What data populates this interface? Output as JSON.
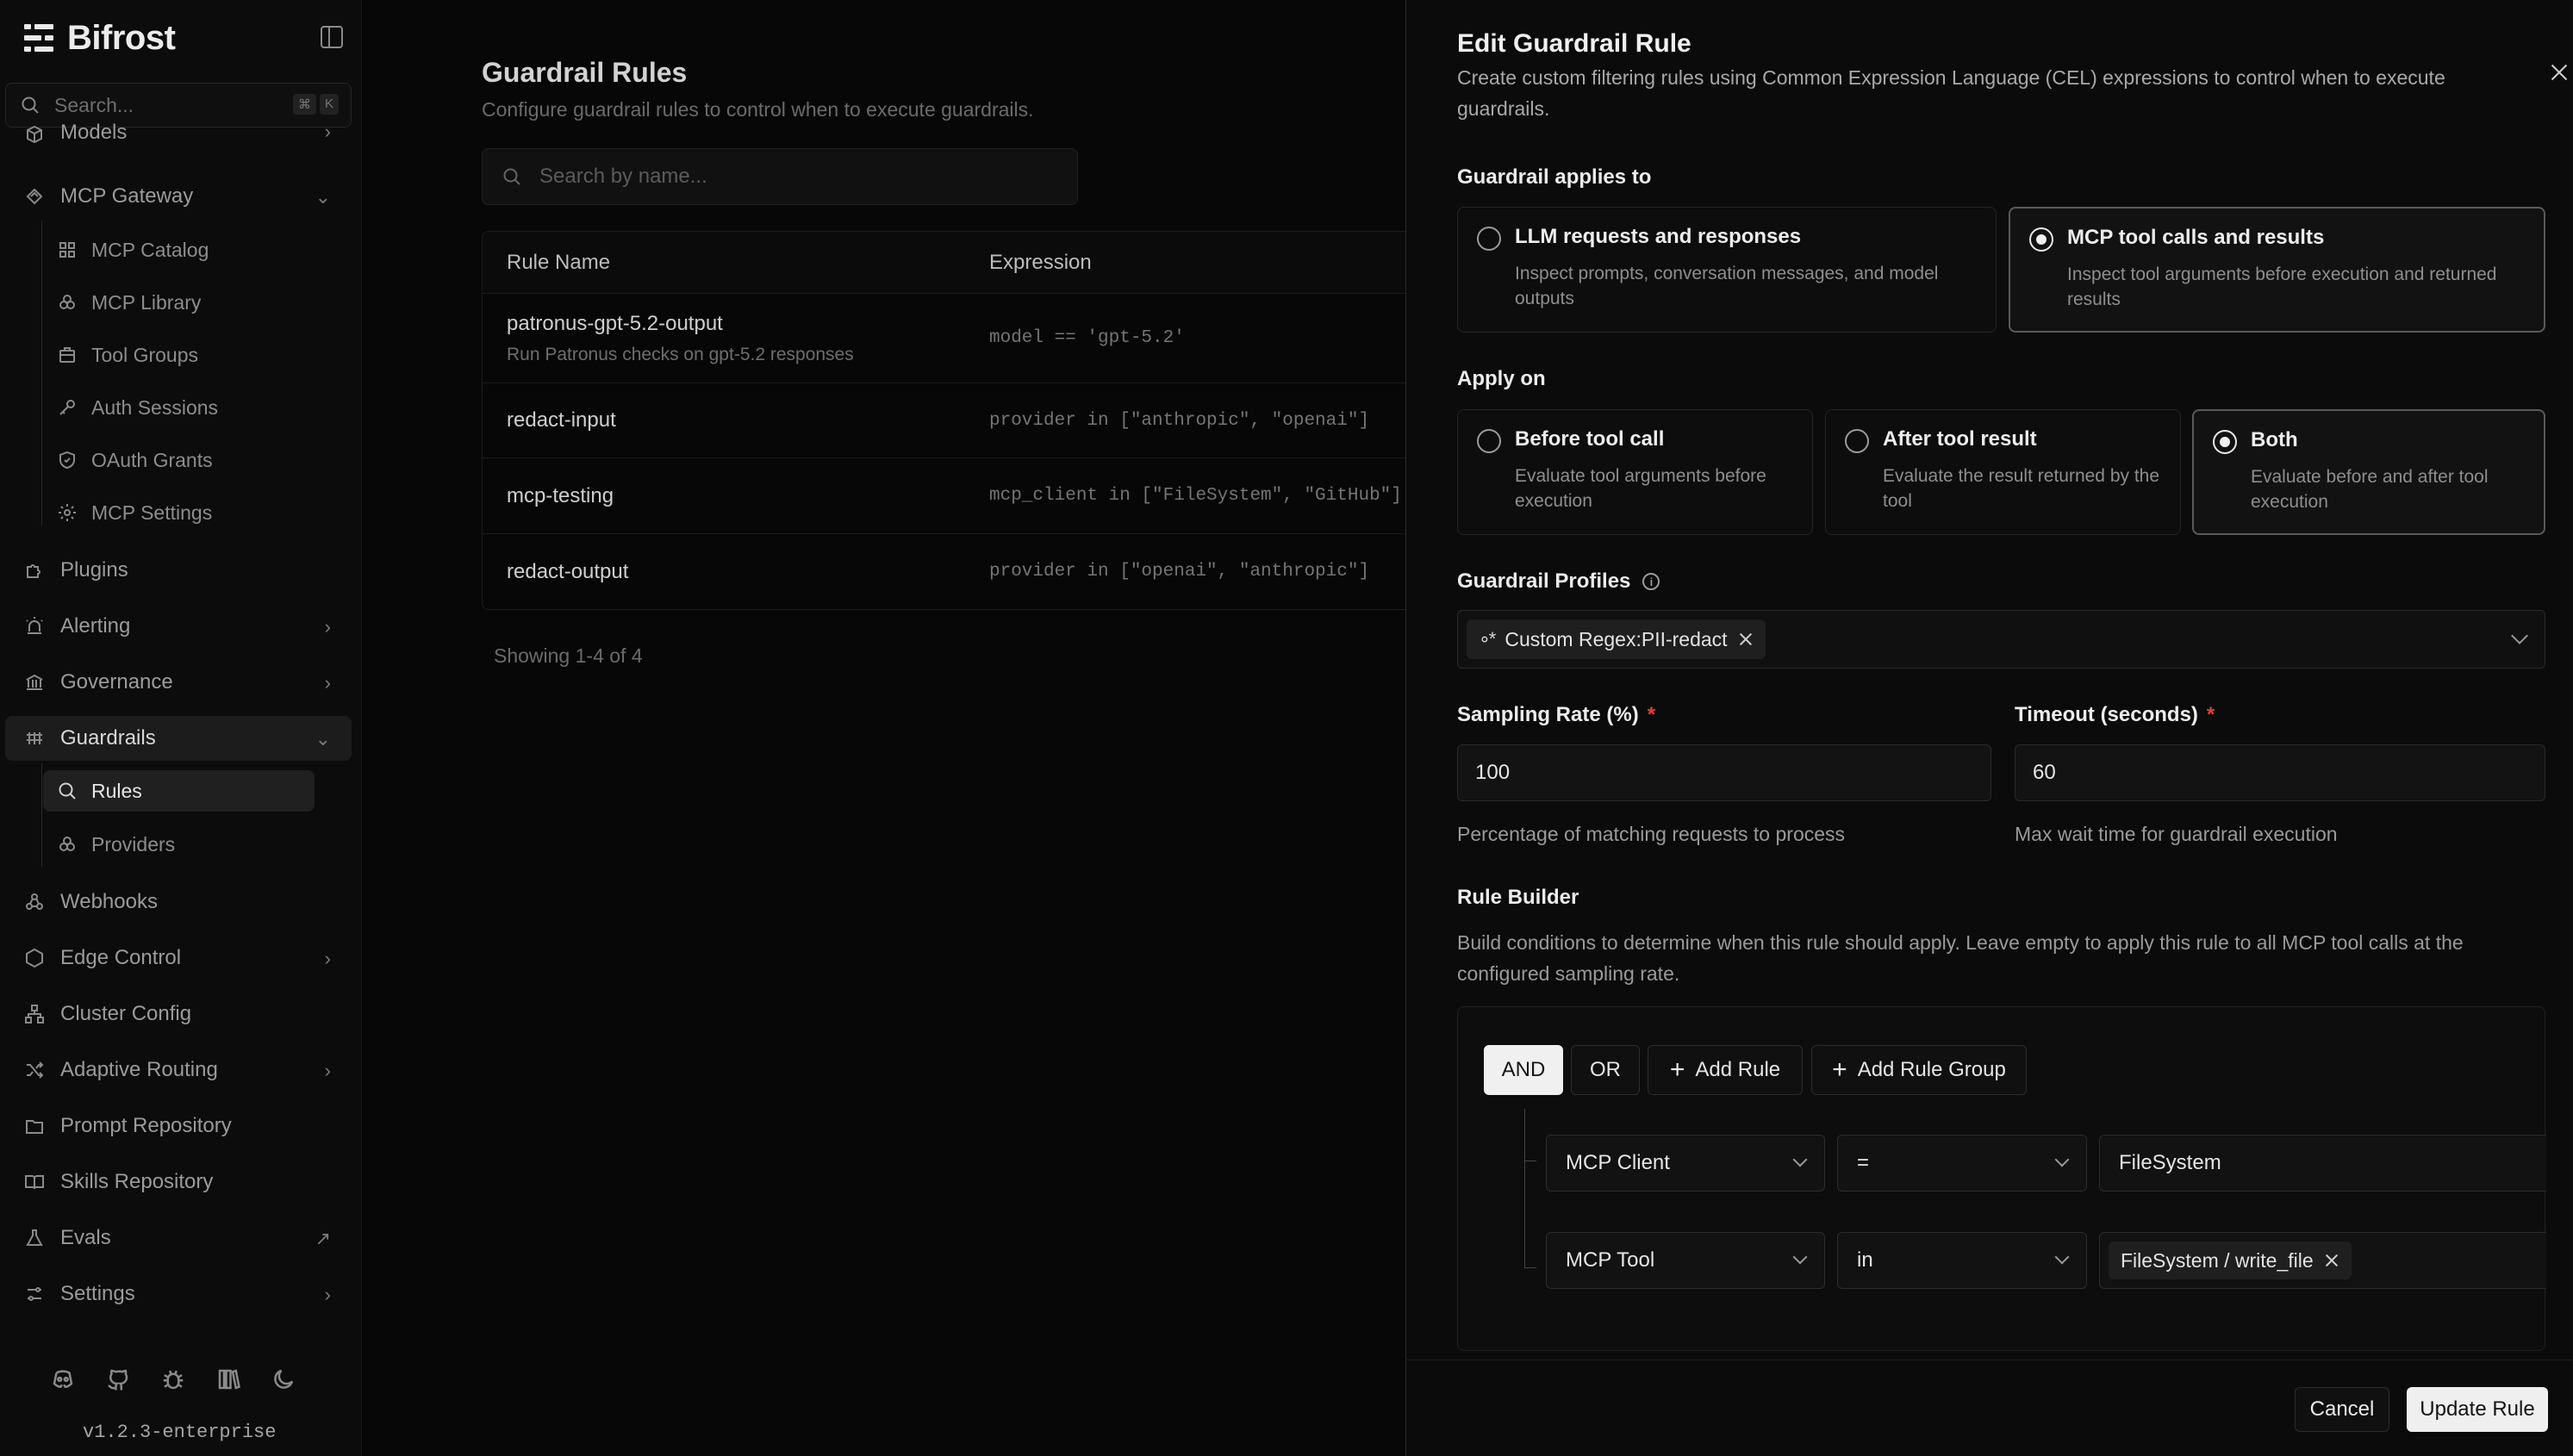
{
  "app": {
    "name": "Bifrost",
    "version": "v1.2.3-enterprise"
  },
  "sidebar": {
    "search_placeholder": "Search...",
    "shortcut": [
      "⌘",
      "K"
    ],
    "items": [
      {
        "label": "Models"
      },
      {
        "label": "MCP Gateway"
      },
      {
        "label": "MCP Catalog"
      },
      {
        "label": "MCP Library"
      },
      {
        "label": "Tool Groups"
      },
      {
        "label": "Auth Sessions"
      },
      {
        "label": "OAuth Grants"
      },
      {
        "label": "MCP Settings"
      },
      {
        "label": "Plugins"
      },
      {
        "label": "Alerting"
      },
      {
        "label": "Governance"
      },
      {
        "label": "Guardrails"
      },
      {
        "label": "Rules"
      },
      {
        "label": "Providers"
      },
      {
        "label": "Webhooks"
      },
      {
        "label": "Edge Control"
      },
      {
        "label": "Cluster Config"
      },
      {
        "label": "Adaptive Routing"
      },
      {
        "label": "Prompt Repository"
      },
      {
        "label": "Skills Repository"
      },
      {
        "label": "Evals"
      },
      {
        "label": "Settings"
      }
    ]
  },
  "main": {
    "title": "Guardrail Rules",
    "subtitle": "Configure guardrail rules to control when to execute guardrails.",
    "search_placeholder": "Search by name...",
    "columns": [
      "Rule Name",
      "Expression"
    ],
    "rows": [
      {
        "name": "patronus-gpt-5.2-output",
        "desc": "Run Patronus checks on gpt-5.2 responses",
        "expr": "model == 'gpt-5.2'"
      },
      {
        "name": "redact-input",
        "desc": "",
        "expr": "provider in [\"anthropic\", \"openai\"]"
      },
      {
        "name": "mcp-testing",
        "desc": "",
        "expr": "mcp_client in [\"FileSystem\", \"GitHub\"]"
      },
      {
        "name": "redact-output",
        "desc": "",
        "expr": "provider in [\"openai\", \"anthropic\"]"
      }
    ],
    "showing": "Showing 1-4 of 4"
  },
  "panel": {
    "title": "Edit Guardrail Rule",
    "description": "Create custom filtering rules using Common Expression Language (CEL) expressions to control when to execute guardrails.",
    "applies_label": "Guardrail applies to",
    "applies_options": [
      {
        "title": "LLM requests and responses",
        "desc": "Inspect prompts, conversation messages, and model outputs",
        "selected": false
      },
      {
        "title": "MCP tool calls and results",
        "desc": "Inspect tool arguments before execution and returned results",
        "selected": true
      }
    ],
    "apply_on_label": "Apply on",
    "apply_on_options": [
      {
        "title": "Before tool call",
        "desc": "Evaluate tool arguments before execution",
        "selected": false
      },
      {
        "title": "After tool result",
        "desc": "Evaluate the result returned by the tool",
        "selected": false
      },
      {
        "title": "Both",
        "desc": "Evaluate before and after tool execution",
        "selected": true
      }
    ],
    "profiles_label": "Guardrail Profiles",
    "profile_chip": "Custom Regex:PII-redact",
    "sampling_label": "Sampling Rate (%)",
    "sampling_value": "100",
    "sampling_help": "Percentage of matching requests to process",
    "timeout_label": "Timeout (seconds)",
    "timeout_value": "60",
    "timeout_help": "Max wait time for guardrail execution",
    "required_mark": "*",
    "builder_label": "Rule Builder",
    "builder_desc": "Build conditions to determine when this rule should apply. Leave empty to apply this rule to all MCP tool calls at the configured sampling rate.",
    "builder": {
      "and_label": "AND",
      "or_label": "OR",
      "add_rule": "Add Rule",
      "add_group": "Add Rule Group",
      "rules": [
        {
          "field": "MCP Client",
          "operator": "=",
          "value": "FileSystem"
        },
        {
          "field": "MCP Tool",
          "operator": "in",
          "value_chip": "FileSystem / write_file"
        }
      ]
    },
    "cancel_label": "Cancel",
    "submit_label": "Update Rule"
  },
  "colors": {
    "accent_light": "#f0f0f0",
    "required": "#e0413b",
    "panel_bg": "#0b0b0b"
  }
}
